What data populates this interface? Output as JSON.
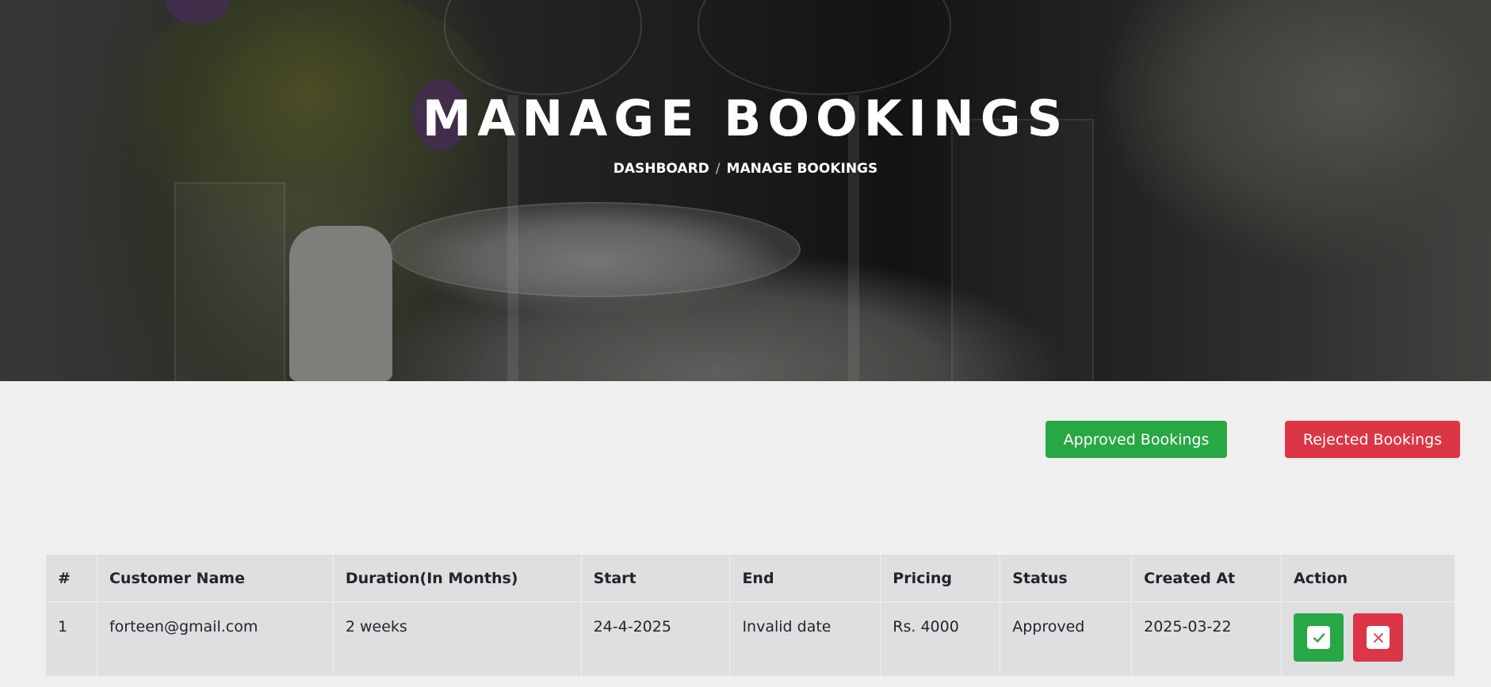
{
  "hero": {
    "title": "MANAGE BOOKINGS",
    "breadcrumb": {
      "home": "DASHBOARD",
      "separator": "/",
      "current": "MANAGE BOOKINGS"
    }
  },
  "actions": {
    "approved_label": "Approved Bookings",
    "rejected_label": "Rejected Bookings"
  },
  "colors": {
    "success": "#28a745",
    "danger": "#dc3545"
  },
  "table": {
    "headers": [
      "#",
      "Customer Name",
      "Duration(In Months)",
      "Start",
      "End",
      "Pricing",
      "Status",
      "Created At",
      "Action"
    ],
    "rows": [
      {
        "index": "1",
        "customer": "forteen@gmail.com",
        "duration": "2 weeks",
        "start": "24-4-2025",
        "end": "Invalid date",
        "pricing": "Rs. 4000",
        "status": "Approved",
        "created_at": "2025-03-22",
        "approve_icon": "check-icon",
        "reject_icon": "close-icon"
      }
    ]
  }
}
